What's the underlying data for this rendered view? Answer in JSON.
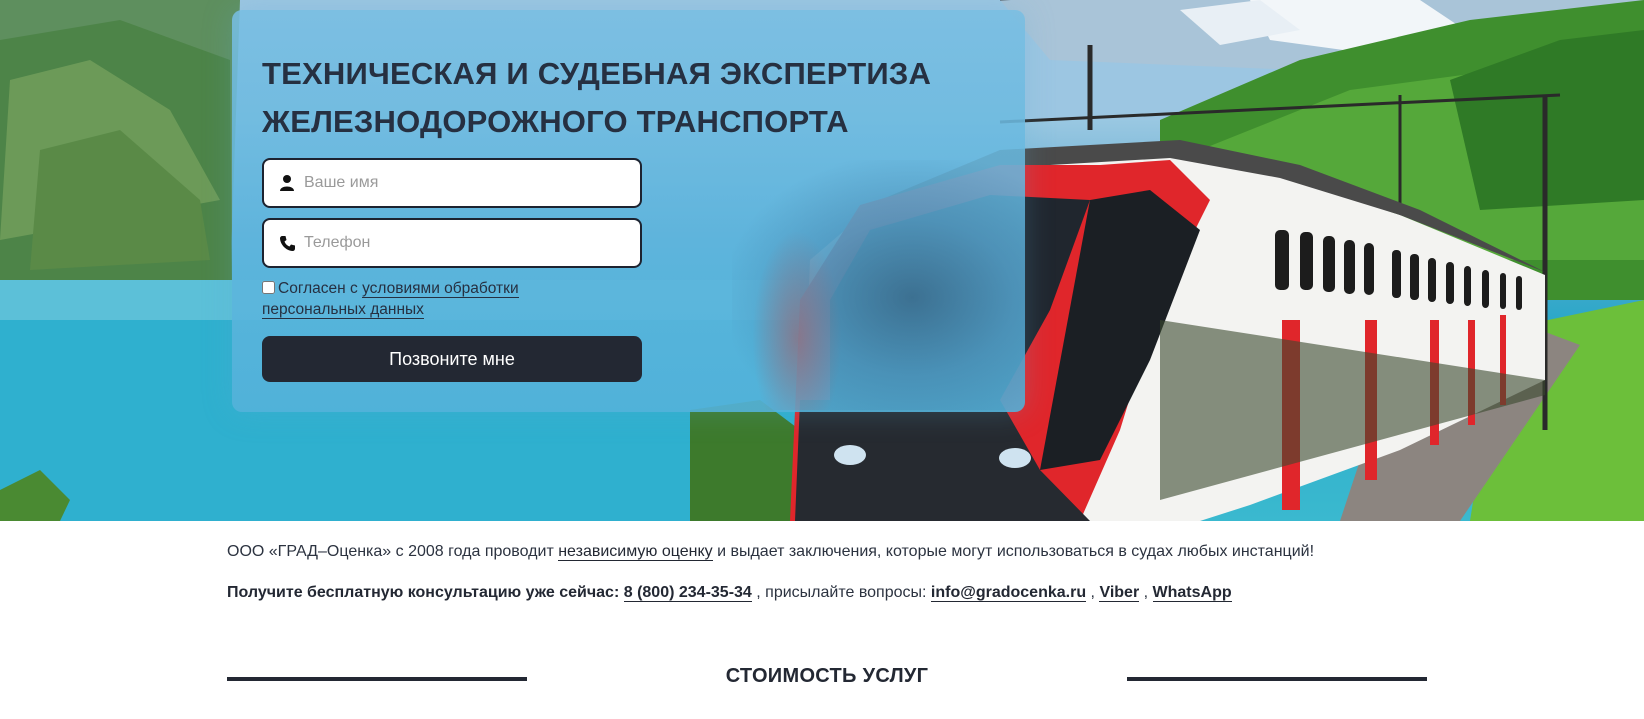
{
  "hero": {
    "title_line1": "ТЕХНИЧЕСКАЯ И СУДЕБНАЯ ЭКСПЕРТИЗА",
    "title_line2": "ЖЕЛЕЗНОДОРОЖНОГО ТРАНСПОРТА",
    "name_placeholder": "Ваше имя",
    "phone_placeholder": "Телефон",
    "name_icon": "user-icon",
    "phone_icon": "phone-icon",
    "consent_prefix": "Согласен с ",
    "consent_link": "условиями обработки персональных данных",
    "submit_label": "Позвоните мне",
    "consent_checked": false
  },
  "info": {
    "line1_prefix": "ООО «ГРАД–Оценка» с 2008 года проводит ",
    "line1_link": "независимую оценку",
    "line1_suffix": " и выдает заключения, которые могут использоваться в судах любых инстанций!",
    "line2_bold": "Получите бесплатную консультацию уже сейчас:",
    "phone": "8 (800) 234-35-34",
    "line2_mid": " , присылайте вопросы: ",
    "email": "info@gradocenka.ru",
    "viber": "Viber",
    "whatsapp": "WhatsApp"
  },
  "section": {
    "title": "СТОИМОСТЬ УСЛУГ"
  },
  "colors": {
    "dark": "#232833",
    "card": "#6ab7de",
    "train_red": "#e0262b"
  }
}
